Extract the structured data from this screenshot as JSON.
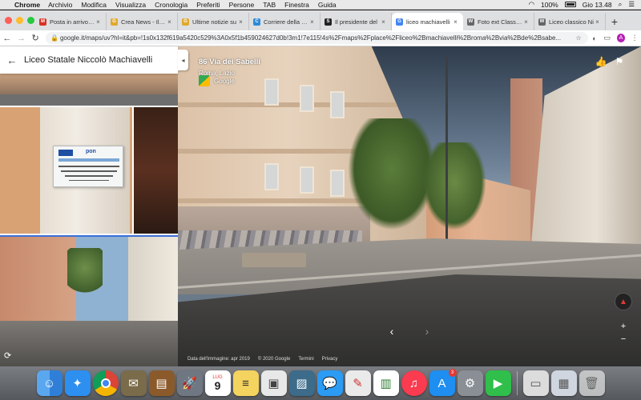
{
  "menubar": {
    "app": "Chrome",
    "items": [
      "Archivio",
      "Modifica",
      "Visualizza",
      "Cronologia",
      "Preferiti",
      "Persone",
      "TAB",
      "Finestra",
      "Guida"
    ],
    "battery": "100%",
    "clock": "Gio 13.48"
  },
  "tabs": [
    {
      "label": "Posta in arrivo (1",
      "fav_color": "#d93025",
      "fav": "M"
    },
    {
      "label": "Crea News - Il Gio",
      "fav_color": "#e0a82e",
      "fav": "G"
    },
    {
      "label": "Ultime notizie su",
      "fav_color": "#e0a82e",
      "fav": "G"
    },
    {
      "label": "Corriere della Sera",
      "fav_color": "#2a8bd8",
      "fav": "C"
    },
    {
      "label": "Il presidente del",
      "fav_color": "#222222",
      "fav": "S"
    },
    {
      "label": "liceo machiavelli",
      "fav_color": "#4285f4",
      "fav": "G",
      "active": true
    },
    {
      "label": "Foto ext Classico",
      "fav_color": "#666666",
      "fav": "W"
    },
    {
      "label": "Liceo classico Ni",
      "fav_color": "#666666",
      "fav": "W"
    }
  ],
  "toolbar": {
    "url": "google.it/maps/uv?hl=it&pb=!1s0x132f619a5420c529%3A0x5f1b459024627d0b!3m1!7e115!4s%2Fmaps%2Fplace%2Fliceo%2Bmachiavelli%2Broma%2Bvia%2Bde%2Bsabe...",
    "profile_initial": "A"
  },
  "panel": {
    "title": "Liceo Statale Niccolò Machiavelli",
    "plaque_logo": "pon"
  },
  "streetview": {
    "address": "86 Via dei Sabelli",
    "city": "Roma, Lazio",
    "source": "Google",
    "footer": [
      "Data dell'immagine: apr 2019",
      "© 2020 Google",
      "Termini",
      "Privacy"
    ]
  },
  "dock": {
    "calendar_month": "LUG",
    "calendar_day": "9",
    "appstore_badge": "3"
  }
}
